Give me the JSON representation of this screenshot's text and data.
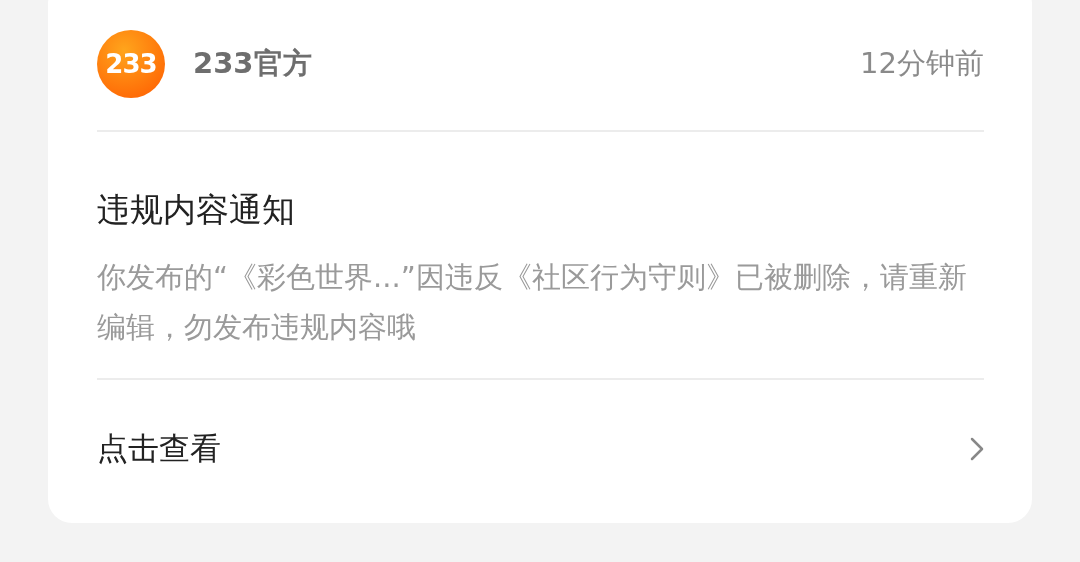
{
  "header": {
    "logo_text": "233",
    "sender": "233官方",
    "time": "12分钟前"
  },
  "notice": {
    "title": "违规内容通知",
    "body": "你发布的“《彩色世界...”因违反《社区行为守则》已被删除，请重新编辑，勿发布违规内容哦"
  },
  "action": {
    "label": "点击查看"
  }
}
